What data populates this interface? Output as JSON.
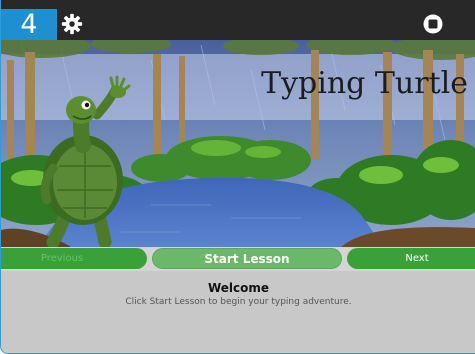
{
  "toolbar": {
    "level": "4",
    "settings_icon": "gear-icon",
    "stop_icon": "stop-icon"
  },
  "scene": {
    "title": "Typing Turtle"
  },
  "buttons": {
    "previous_label": "Previous",
    "start_label": "Start Lesson",
    "next_label": "Next"
  },
  "message": {
    "title": "Welcome",
    "text": "Click Start Lesson to begin your typing adventure."
  },
  "colors": {
    "accent": "#1e8fd0",
    "toolbar_bg": "#282828",
    "button_green": "#3aa13a",
    "button_green_light": "#6cb86a",
    "panel_bg": "#c8c8c8"
  }
}
